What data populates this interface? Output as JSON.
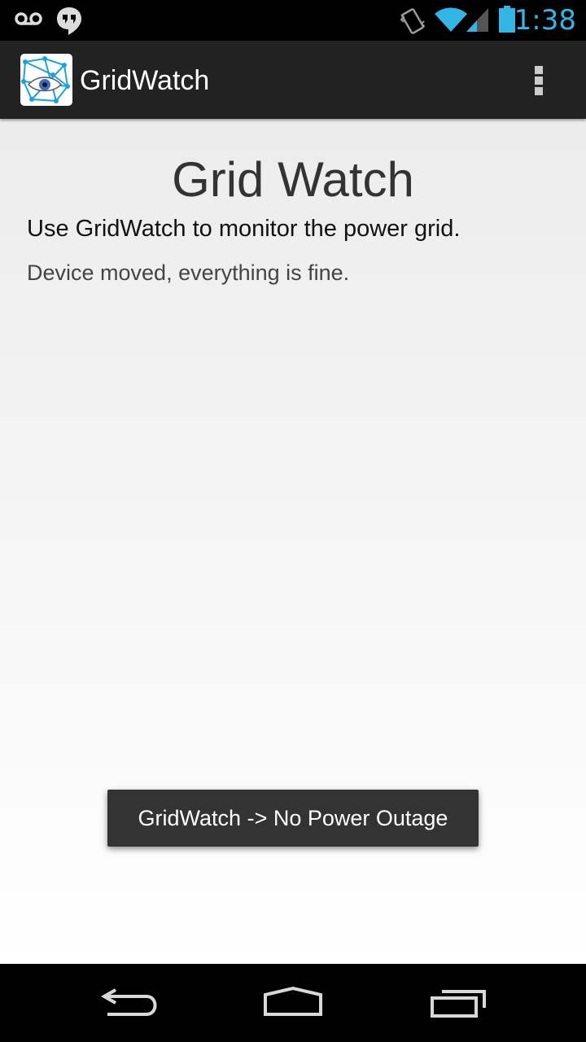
{
  "status_bar": {
    "time": "1:38",
    "icons": [
      "voicemail-icon",
      "hangouts-icon",
      "vibrate-icon",
      "wifi-icon",
      "signal-icon",
      "battery-icon"
    ],
    "accent_color": "#33b5e5"
  },
  "action_bar": {
    "title": "GridWatch",
    "app_icon": "gridwatch-eye-logo-icon",
    "menu_icon": "overflow-menu-icon"
  },
  "main": {
    "heading": "Grid Watch",
    "subtitle": "Use GridWatch to monitor the power grid.",
    "status": "Device moved, everything is fine."
  },
  "toast": {
    "message": "GridWatch -> No Power Outage"
  },
  "nav_bar": {
    "buttons": [
      "back-icon",
      "home-icon",
      "recent-apps-icon"
    ]
  }
}
